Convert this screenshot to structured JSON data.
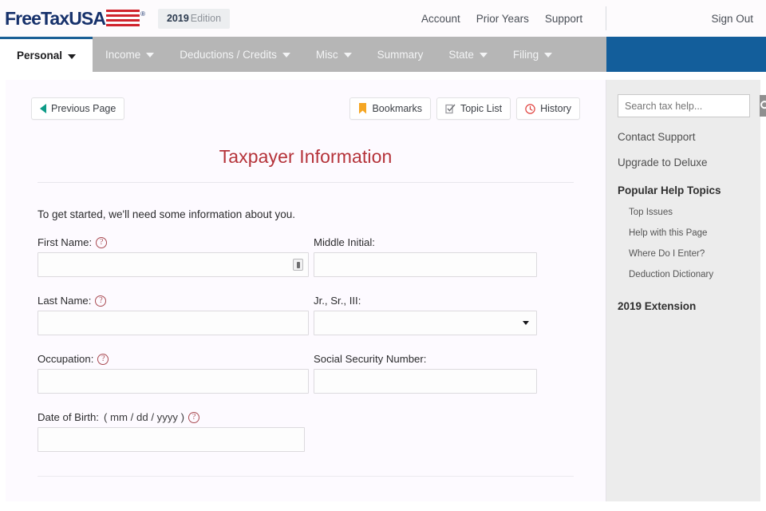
{
  "header": {
    "logo_text": "FreeTaxUSA",
    "logo_reg": "®",
    "edition_year": "2019",
    "edition_label": "Edition",
    "links": [
      {
        "label": "Account"
      },
      {
        "label": "Prior Years"
      },
      {
        "label": "Support"
      }
    ],
    "sign_out": "Sign Out"
  },
  "nav": {
    "items": [
      {
        "label": "Personal",
        "has_caret": true,
        "active": true
      },
      {
        "label": "Income",
        "has_caret": true,
        "active": false
      },
      {
        "label": "Deductions / Credits",
        "has_caret": true,
        "active": false
      },
      {
        "label": "Misc",
        "has_caret": true,
        "active": false
      },
      {
        "label": "Summary",
        "has_caret": false,
        "active": false
      },
      {
        "label": "State",
        "has_caret": true,
        "active": false
      },
      {
        "label": "Filing",
        "has_caret": true,
        "active": false
      }
    ]
  },
  "toolbar": {
    "previous_page": "Previous Page",
    "bookmarks": "Bookmarks",
    "topic_list": "Topic List",
    "history": "History"
  },
  "main": {
    "title": "Taxpayer Information",
    "intro": "To get started, we'll need some information about you.",
    "fields": {
      "first_name": {
        "label": "First Name:",
        "value": "",
        "help": true
      },
      "middle_initial": {
        "label": "Middle Initial:",
        "value": "",
        "help": false
      },
      "last_name": {
        "label": "Last Name:",
        "value": "",
        "help": true
      },
      "suffix": {
        "label": "Jr., Sr., III:",
        "value": "",
        "help": false
      },
      "occupation": {
        "label": "Occupation:",
        "value": "",
        "help": true
      },
      "ssn": {
        "label": "Social Security Number:",
        "value": "",
        "help": false
      },
      "dob": {
        "label": "Date of Birth:",
        "format": "( mm / dd / yyyy )",
        "value": "",
        "help": true
      }
    },
    "help_glyph": "?"
  },
  "sidebar": {
    "search_placeholder": "Search tax help...",
    "search_value": "",
    "links": [
      {
        "label": "Contact Support"
      },
      {
        "label": "Upgrade to Deluxe"
      }
    ],
    "popular_heading": "Popular Help Topics",
    "topics": [
      {
        "label": "Top Issues"
      },
      {
        "label": "Help with this Page"
      },
      {
        "label": "Where Do I Enter?"
      },
      {
        "label": "Deduction Dictionary"
      }
    ],
    "extension_heading": "2019 Extension"
  },
  "colors": {
    "brand_navy": "#16316b",
    "brand_red": "#d0232c",
    "nav_blue": "#135e9b",
    "nav_grey": "#b6b6b6",
    "title_red": "#b5333a",
    "teal": "#0d9b87",
    "bookmark_orange": "#f5a623",
    "history_red": "#e0403c"
  }
}
